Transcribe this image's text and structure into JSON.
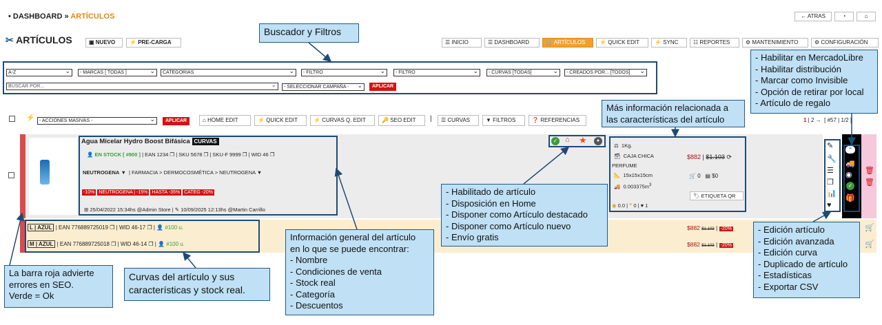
{
  "breadcrumb": {
    "home": "DASHBOARD",
    "separator": "»",
    "current": "ARTÍCULOS"
  },
  "top_right": {
    "back": "ATRAS"
  },
  "title": "ARTÍCULOS",
  "header_buttons": {
    "new": "NUEVO",
    "preload": "PRE-CARGA"
  },
  "nav": [
    "INICIO",
    "DASHBOARD",
    "ARTÍCULOS",
    "QUICK EDIT",
    "SYNC",
    "REPORTES",
    "MANTENIMIENTO",
    "CONFIGURACIÓN"
  ],
  "filters": {
    "sort": "A-Z",
    "brands": "- MARCAS [ TODAS ]",
    "categories": "CATEGORIAS",
    "filter1": "- FILTRO",
    "filter2": "- FILTRO",
    "curves": "- CURVAS [TODAS]",
    "created": "- CREADOS POR... [TODOS]",
    "search_placeholder": "BUSCAR POR...",
    "campaign": "- SELECCIONAR CAMPAÑA -",
    "apply": "APLICAR"
  },
  "toolbar": {
    "mass_actions": "- ACCIONES MASIVAS -",
    "apply": "APLICAR",
    "buttons": [
      "HOME EDIT",
      "QUICK EDIT",
      "CURVAS Q. EDIT",
      "SEO EDIT",
      "CURVAS",
      "FILTROS",
      "REFERENCIAS"
    ],
    "pagination": {
      "current": "1",
      "next": "2",
      "item": "#57",
      "pages": "1/2"
    }
  },
  "product": {
    "name": "Agua Micelar Hydro Boost Bifásica",
    "curves_tag": "CURVAS",
    "stock": "EN STOCK [ #900 ]",
    "ean": "EAN 1234",
    "sku": "SKU 5678",
    "skuf": "SKU-F 9999",
    "wid": "WID 46",
    "brand": "NEUTROGENA",
    "category_path": "FARMACIA > DERMOCOSMÉTICA > NEUTROGENA",
    "discounts": [
      "-10%",
      "NEUTROGENA | -15%",
      "HASTA -35%",
      "CATEG -20%"
    ],
    "created": "25/04/2022 15:34hs @Admin Store",
    "edited": "10/09/2025 12:13hs @Martin Carrillo",
    "weight": "1Kg.",
    "box": "CAJA CHICA",
    "box_label": "PERFUME",
    "dims": "15x15x15cm",
    "volume": "0.003375m",
    "volume_exp": "3",
    "price": "$882",
    "old_price": "$1.103",
    "cart_count": "0",
    "extra": "$0",
    "qr_label": "ETIQUETA QR",
    "ratings": {
      "views": "0.0",
      "comments": "0",
      "likes": "1"
    }
  },
  "variants": [
    {
      "label": "L | AZUL",
      "ean": "EAN 776889725019",
      "wid": "WID 46-17",
      "stock": "#100 u.",
      "price": "$882",
      "old": "$1.103",
      "disc": "-20%"
    },
    {
      "label": "M | AZUL",
      "ean": "EAN 776889725018",
      "wid": "WID 46-14",
      "stock": "#100 u.",
      "price": "$882",
      "old": "$1.103",
      "disc": "-20%"
    }
  ],
  "callouts": {
    "search": "Buscador y Filtros",
    "ml": [
      "- Habilitar en MercadoLibre",
      "- Habilitar distribución",
      "- Marcar como Invisible",
      "- Opción de retirar por local",
      "- Artículo de regalo"
    ],
    "more_info": [
      "Más información relacionada a",
      "las características del artículo"
    ],
    "flags": [
      "- Habilitado de artículo",
      "- Disposición en Home",
      "- Disponer como Artículo destacado",
      "- Disponer como Artículo nuevo",
      "- Envío gratis"
    ],
    "general": [
      "Información general del artículo",
      "en lo que se puede encontrar:",
      "- Nombre",
      "- Condiciones de venta",
      "- Stock real",
      "- Categoría",
      "- Descuentos"
    ],
    "curves": [
      "Curvas del artículo y sus",
      "características y stock real."
    ],
    "seo": [
      "La barra roja advierte",
      "errores en SEO.",
      "Verde = Ok"
    ],
    "edit": [
      "- Edición artículo",
      "- Edición avanzada",
      "- Edición curva",
      "- Duplicado de artículo",
      "- Estadísticas",
      "- Exportar CSV"
    ]
  }
}
